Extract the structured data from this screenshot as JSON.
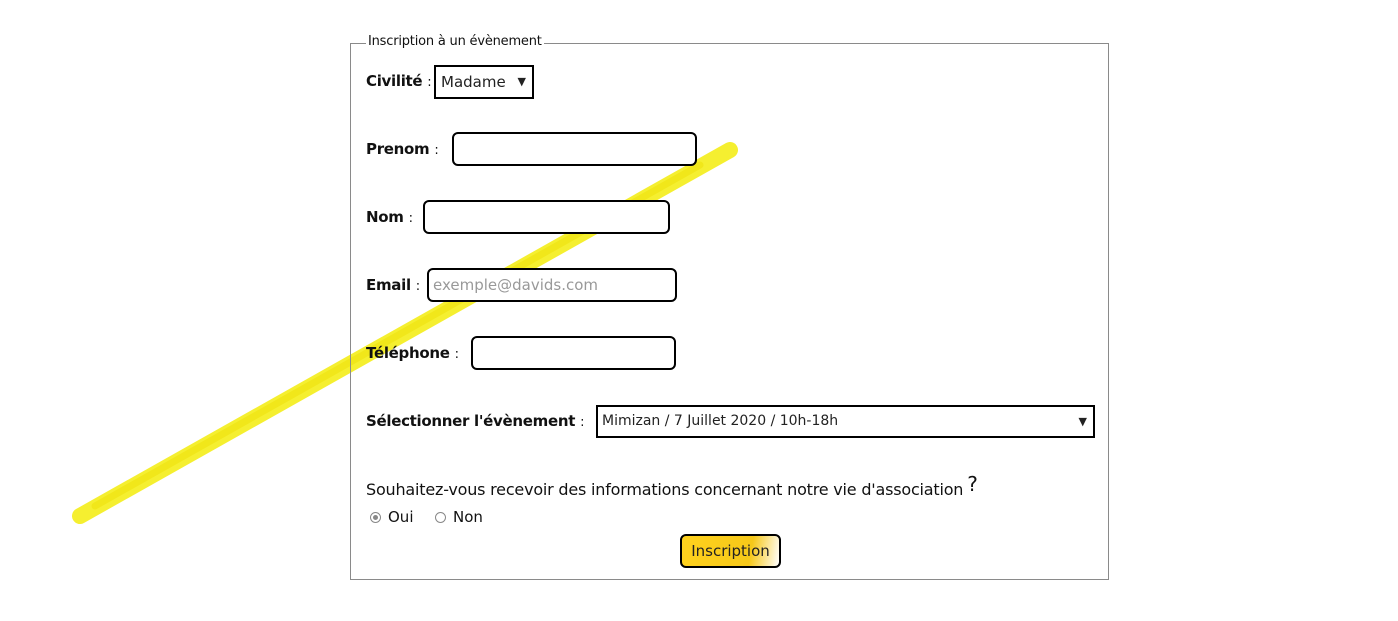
{
  "form": {
    "legend": "Inscription à un évènement",
    "civilite": {
      "label": "Civilité",
      "sep": ":",
      "value": "Madame"
    },
    "prenom": {
      "label": "Prenom",
      "sep": ":",
      "value": ""
    },
    "nom": {
      "label": "Nom",
      "sep": ":",
      "value": ""
    },
    "email": {
      "label": "Email",
      "sep": ":",
      "placeholder": "exemple@davids.com"
    },
    "telephone": {
      "label": "Téléphone",
      "sep": ":",
      "value": ""
    },
    "evenement": {
      "label": "Sélectionner l'évènement",
      "sep": ":",
      "value": "Mimizan / 7 Juillet 2020 / 10h-18h"
    },
    "question": {
      "text": "Souhaitez-vous recevoir des informations concernant notre vie d'association",
      "mark": "?"
    },
    "options": [
      {
        "label": "Oui",
        "checked": true
      },
      {
        "label": "Non",
        "checked": false
      }
    ],
    "submit_label": "Inscription"
  },
  "colors": {
    "highlight": "#f5ee1a",
    "button_fill": "#ffd21e"
  }
}
